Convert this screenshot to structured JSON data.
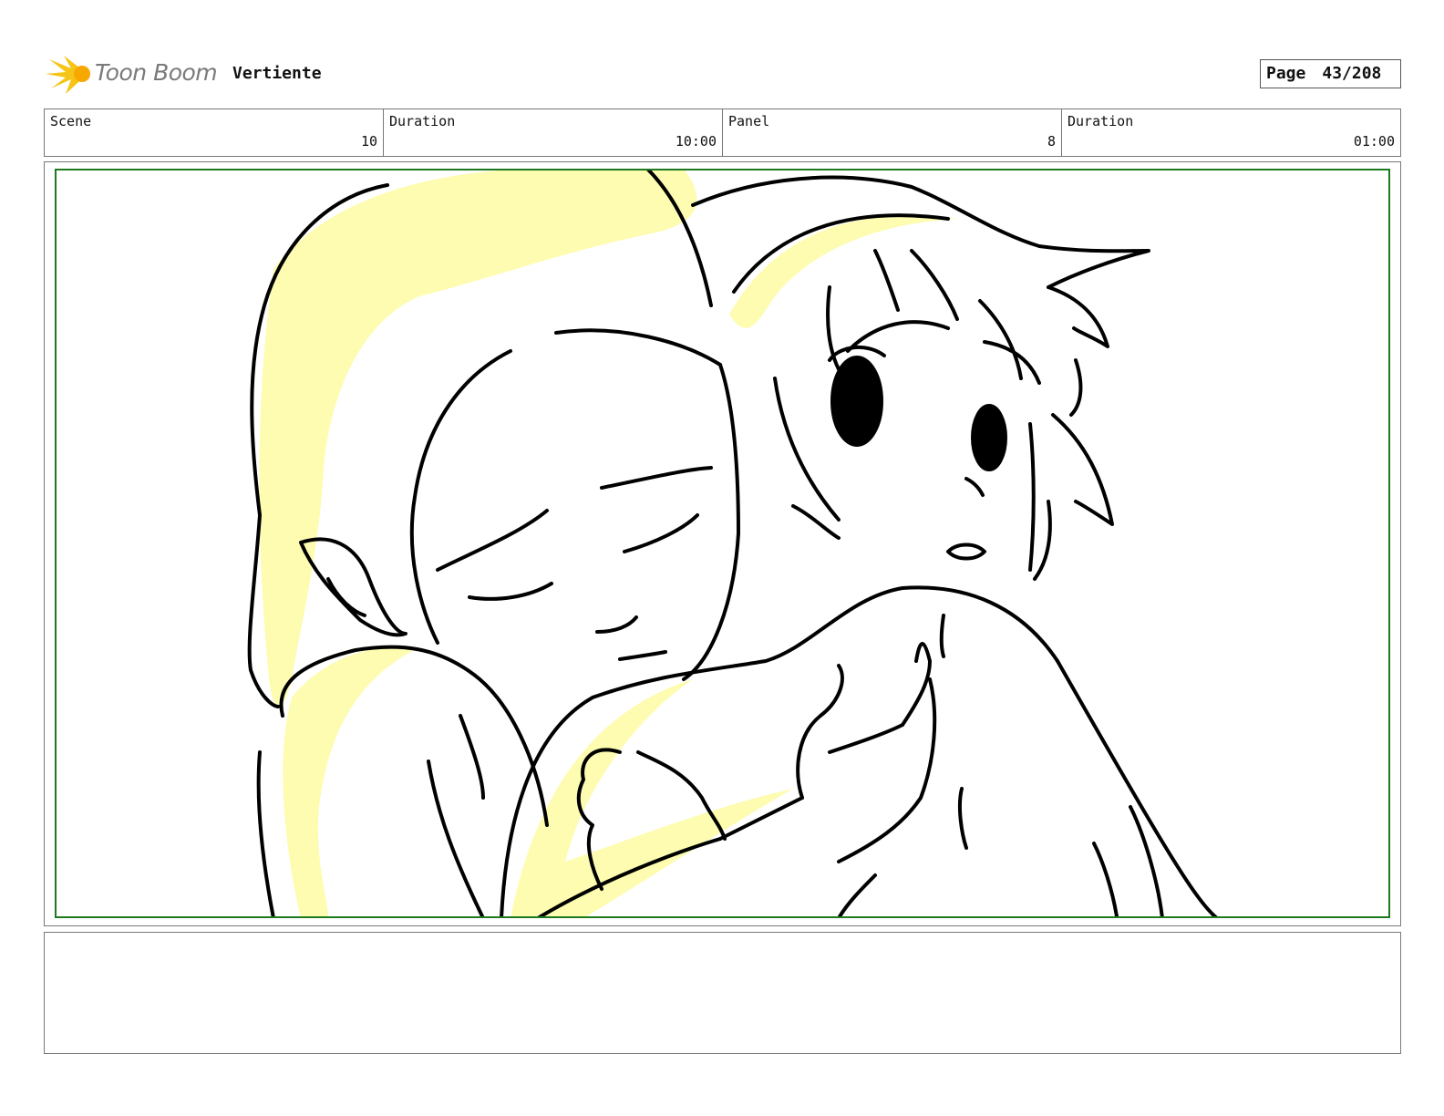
{
  "header": {
    "logo_text": "Toon Boom",
    "project_title": "Vertiente",
    "page_label": "Page",
    "page_number": "43/208"
  },
  "info": {
    "scene_label": "Scene",
    "scene_value": "10",
    "scene_duration_label": "Duration",
    "scene_duration_value": "10:00",
    "panel_label": "Panel",
    "panel_value": "8",
    "panel_duration_label": "Duration",
    "panel_duration_value": "01:00"
  },
  "colors": {
    "frame_border": "#1f7a1f",
    "highlight": "#fdfcb0",
    "logo_burst": "#f5c518",
    "ink": "#000000"
  }
}
